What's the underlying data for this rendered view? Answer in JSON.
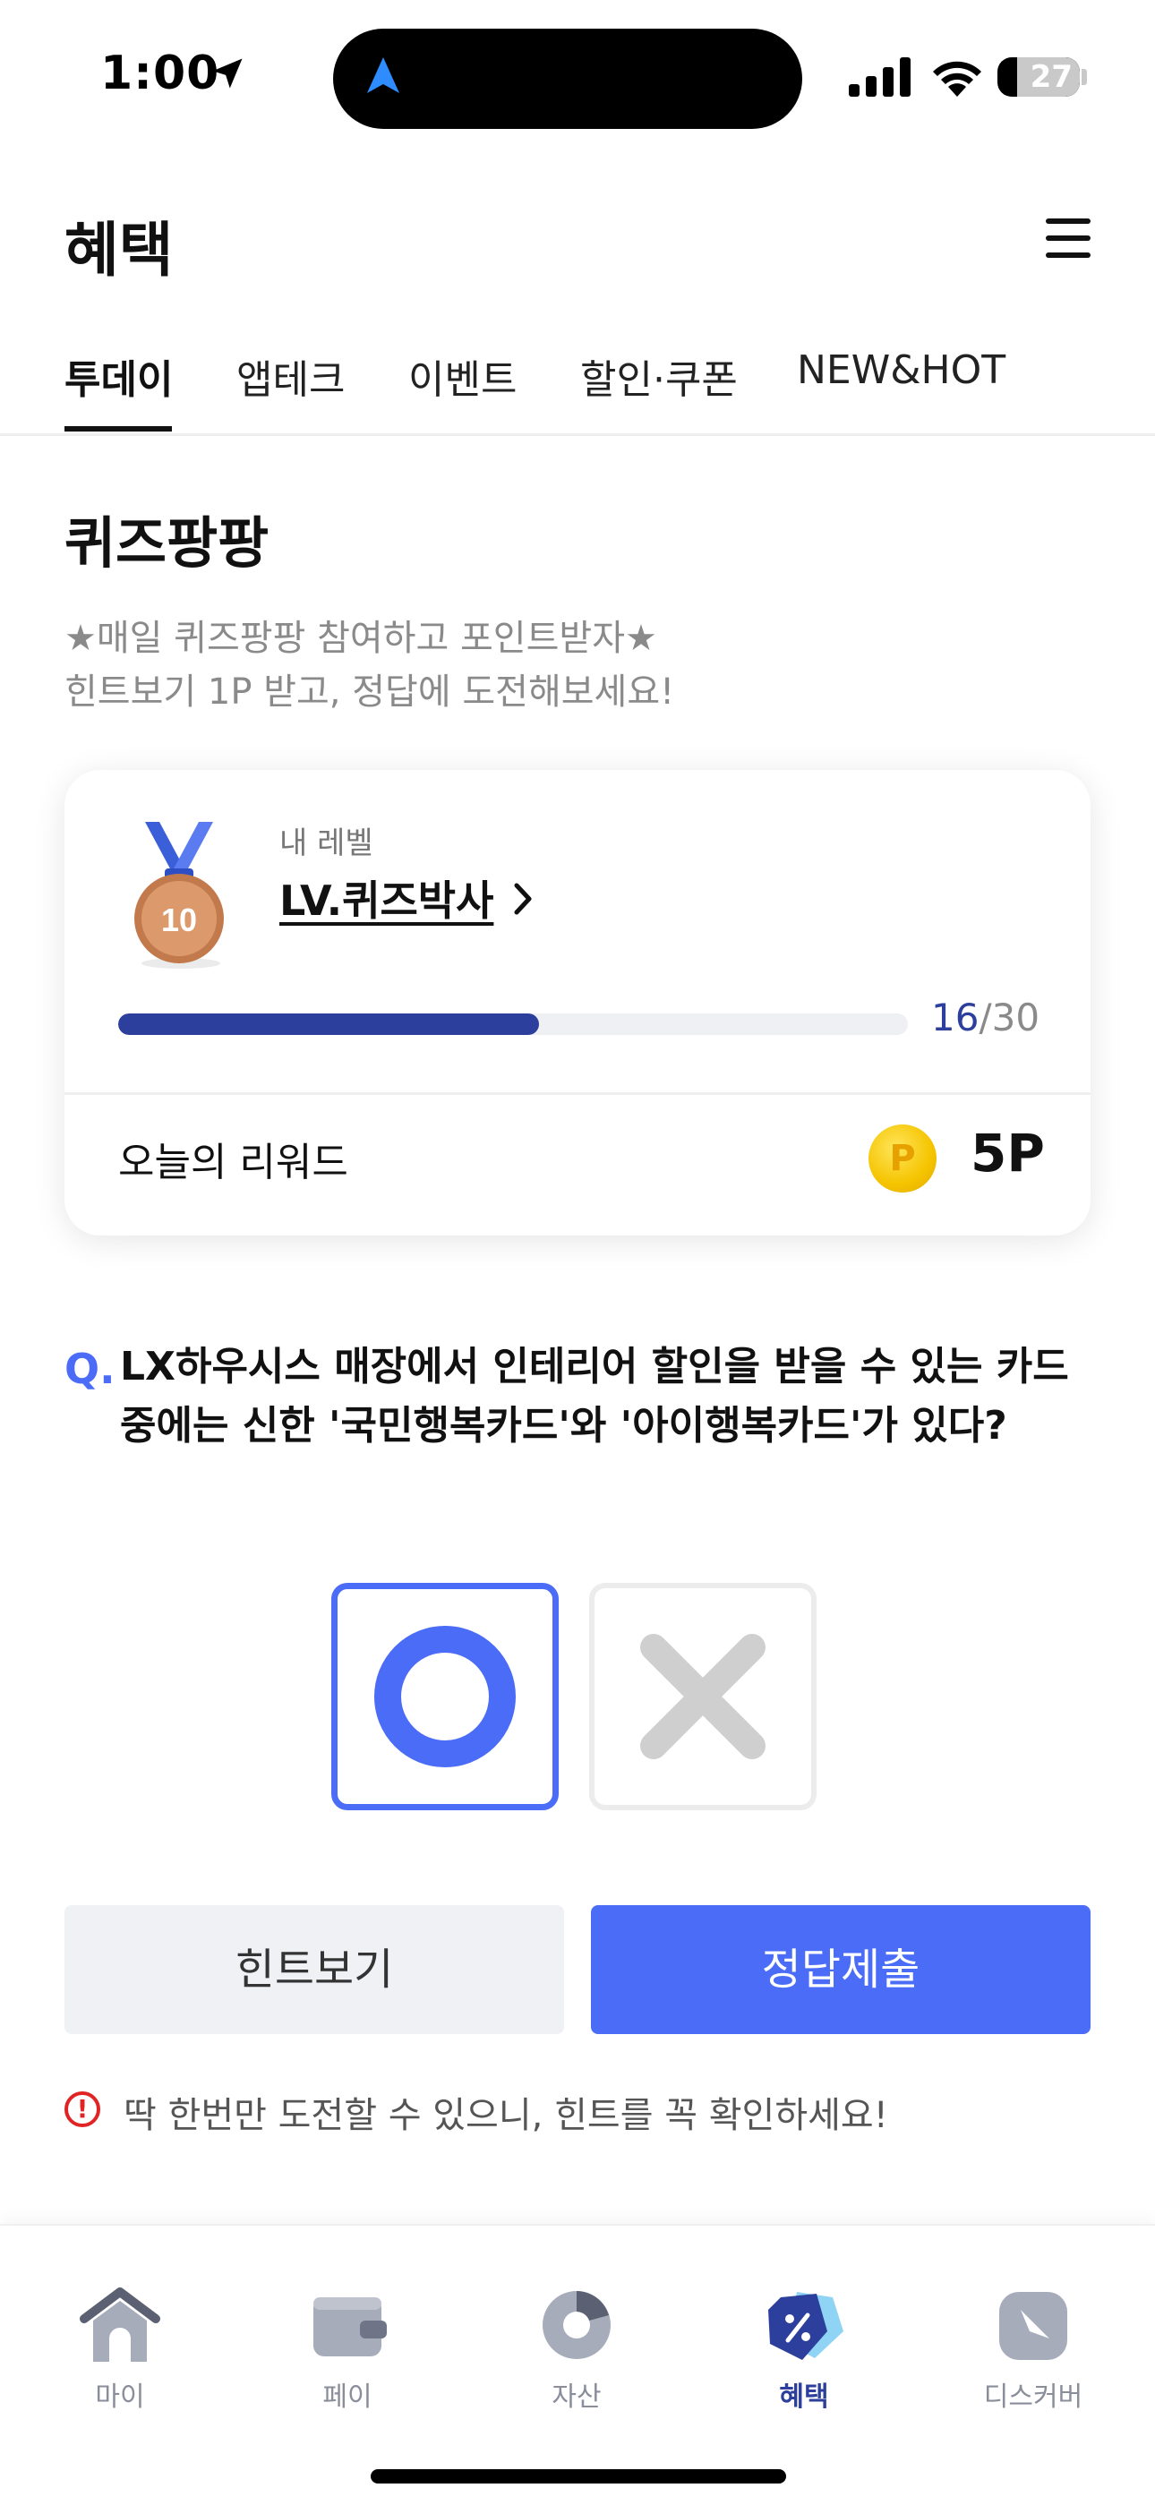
{
  "status_bar": {
    "time": "1:00",
    "battery": "27"
  },
  "header": {
    "title": "혜택"
  },
  "tabs": [
    {
      "label": "투데이",
      "active": true
    },
    {
      "label": "앱테크",
      "active": false
    },
    {
      "label": "이벤트",
      "active": false
    },
    {
      "label": "할인·쿠폰",
      "active": false
    },
    {
      "label": "NEW&HOT",
      "active": false
    }
  ],
  "quiz": {
    "title": "퀴즈팡팡",
    "description_lines": [
      "★매일 퀴즈팡팡 참여하고 포인트받자★",
      "힌트보기 1P 받고, 정답에 도전해보세요!"
    ],
    "level_card": {
      "medal_number": "10",
      "level_label": "내 레벨",
      "level_name": "LV.퀴즈박사",
      "progress_current": "16",
      "progress_total": "/30",
      "progress_fraction": 0.533,
      "reward_label": "오늘의 리워드",
      "coin_symbol": "P",
      "reward_value": "5P"
    },
    "question_prefix": "Q.",
    "question": "LX하우시스 매장에서 인테리어 할인을 받을 수 있는 카드 중에는 신한 '국민행복카드'와 '아이행복카드'가 있다?",
    "options": [
      {
        "name": "O",
        "selected": true
      },
      {
        "name": "X",
        "selected": false
      }
    ],
    "hint_button": "힌트보기",
    "submit_button": "정답제출",
    "warning": "딱 한번만 도전할 수 있으니, 힌트를 꼭 확인하세요!",
    "warning_icon_glyph": "!"
  },
  "bottom_nav": [
    {
      "label": "마이",
      "icon": "home-icon",
      "active": false
    },
    {
      "label": "페이",
      "icon": "wallet-icon",
      "active": false
    },
    {
      "label": "자산",
      "icon": "pie-chart-icon",
      "active": false
    },
    {
      "label": "혜택",
      "icon": "benefit-tag-icon",
      "active": true
    },
    {
      "label": "디스커버",
      "icon": "compass-icon",
      "active": false
    }
  ],
  "colors": {
    "accent": "#4a6cf7",
    "progress": "#2d3f9c",
    "nav_inactive": "#8a8e9a",
    "warning": "#e02424"
  }
}
